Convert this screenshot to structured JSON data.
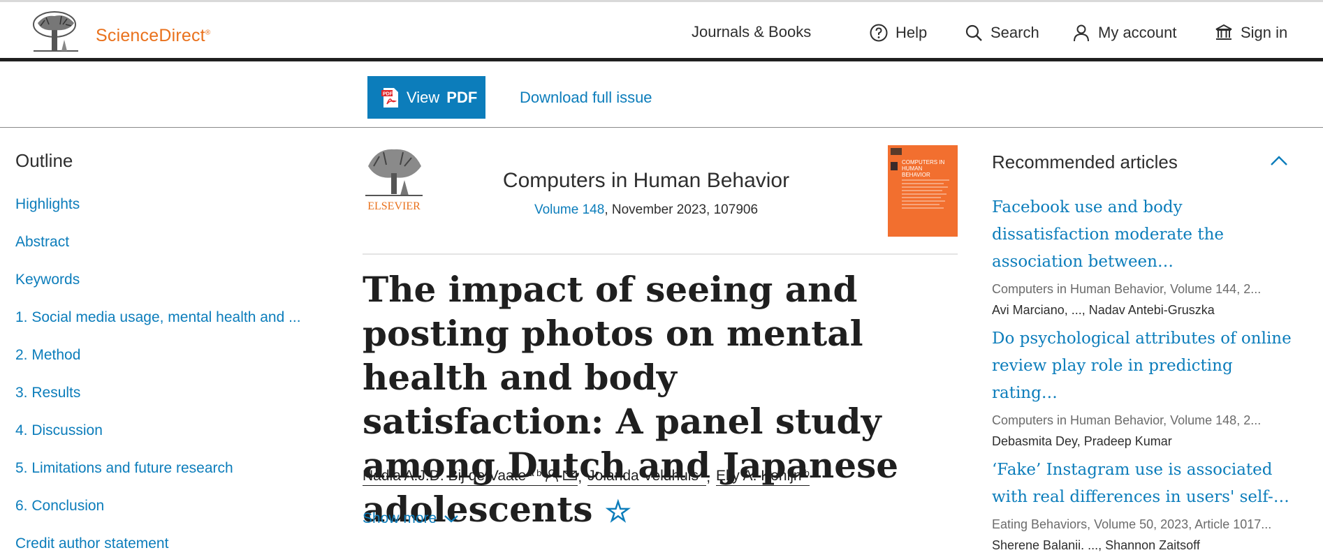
{
  "header": {
    "brand": "ScienceDirect",
    "brand_mark": "®",
    "nav": {
      "journals": "Journals & Books",
      "help": "Help",
      "search": "Search",
      "account": "My account",
      "signin": "Sign in"
    }
  },
  "toolbar": {
    "view_pdf_prefix": "View",
    "view_pdf_bold": "PDF",
    "download": "Download full issue"
  },
  "outline": {
    "title": "Outline",
    "items": [
      "Highlights",
      "Abstract",
      "Keywords",
      "1. Social media usage, mental health and ...",
      "2. Method",
      "3. Results",
      "4. Discussion",
      "5. Limitations and future research",
      "6. Conclusion",
      "Credit author statement"
    ]
  },
  "journal": {
    "publisher": "ELSEVIER",
    "name": "Computers in Human Behavior",
    "volume_link": "Volume 148",
    "volume_rest": ", November 2023, 107906",
    "cover_text": "COMPUTERS IN HUMAN BEHAVIOR"
  },
  "article": {
    "title": "The impact of seeing and posting photos on mental health and body satisfaction: A panel study among Dutch and Japanese adolescents",
    "authors": [
      {
        "name": "Nadia A.J.D. Bij de Vaate",
        "sup": "a b"
      },
      {
        "name": "Jolanda Veldhuis",
        "sup": "b"
      },
      {
        "name": "Elly A. Konijn",
        "sup": "b"
      }
    ],
    "separator": ",",
    "show_more": "Show more"
  },
  "recommended": {
    "title": "Recommended articles",
    "items": [
      {
        "title": "Facebook use and body dissatisfaction moderate the association between…",
        "source": "Computers in Human Behavior, Volume 144, 2...",
        "authors": "Avi Marciano, ..., Nadav Antebi-Gruszka"
      },
      {
        "title": "Do psychological attributes of online review play role in predicting rating…",
        "source": "Computers in Human Behavior, Volume 148, 2...",
        "authors": "Debasmita Dey, Pradeep Kumar"
      },
      {
        "title": "‘Fake’ Instagram use is associated with real differences in users' self-…",
        "source": "Eating Behaviors, Volume 50, 2023, Article 1017...",
        "authors": "Sherene Balanii. ..., Shannon Zaitsoff"
      }
    ]
  },
  "colors": {
    "accent": "#0c7dbb",
    "brand": "#e9711c",
    "cover": "#f26f2f"
  }
}
